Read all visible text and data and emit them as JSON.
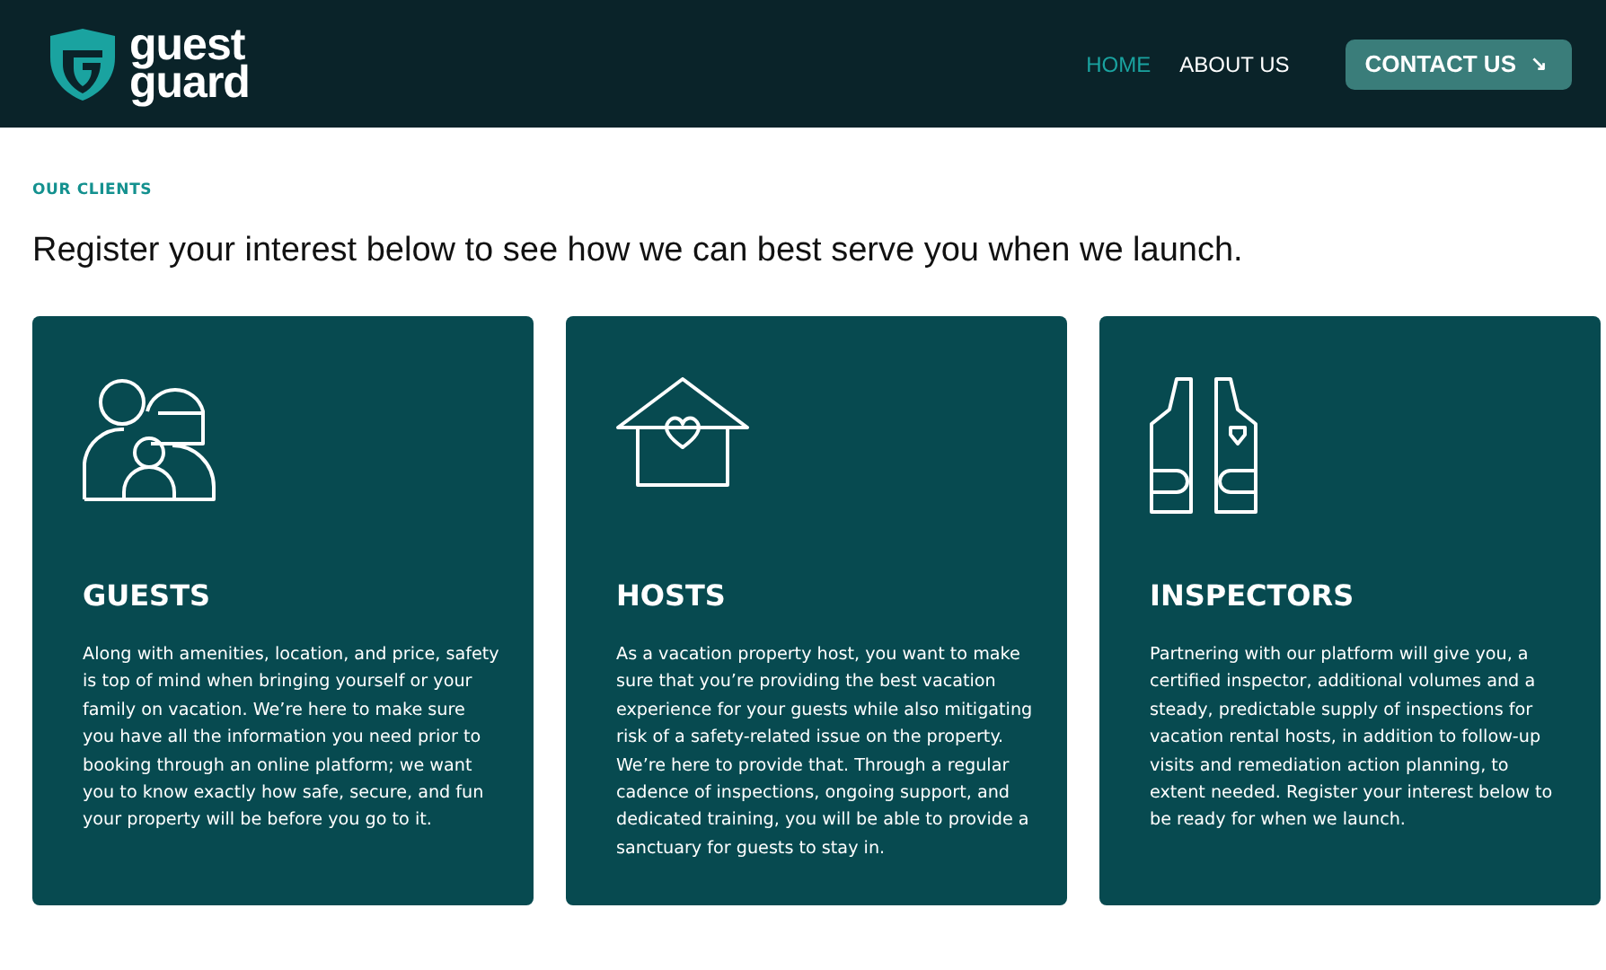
{
  "header": {
    "logo": [
      "guest",
      "guard"
    ],
    "nav": [
      {
        "label": "HOME",
        "selected": true
      },
      {
        "label": "ABOUT US",
        "selected": false
      }
    ],
    "cta": {
      "label": "CONTACT US",
      "icon": "↘"
    }
  },
  "section": {
    "eyebrow": "OUR CLIENTS",
    "heading": "Register your interest below to see how we can best serve you when we launch."
  },
  "cards": [
    {
      "kind": "family",
      "title": "GUESTS",
      "body": "Along with amenities, location, and price, safety is top of mind when bringing yourself or your family on vacation. We’re here to make sure you have all the information you need prior to booking through an online platform; we want you to know exactly how safe, secure, and fun your property will be before you go to it."
    },
    {
      "kind": "house",
      "title": "HOSTS",
      "body": "As a vacation property host, you want to make sure that you’re providing the best vacation experience for your guests while also mitigating risk of a safety-related issue on the property. We’re here to provide that. Through a regular cadence of inspections, ongoing support, and dedicated training, you will be able to provide a sanctuary for guests to stay in."
    },
    {
      "kind": "vest",
      "title": "INSPECTORS",
      "body": "Partnering with our platform will give you, a certified inspector, additional volumes and a steady, predictable supply of inspections for vacation rental hosts, in addition to follow-up visits and remediation action planning, to extent needed. Register your interest below to be ready for when we launch."
    }
  ]
}
